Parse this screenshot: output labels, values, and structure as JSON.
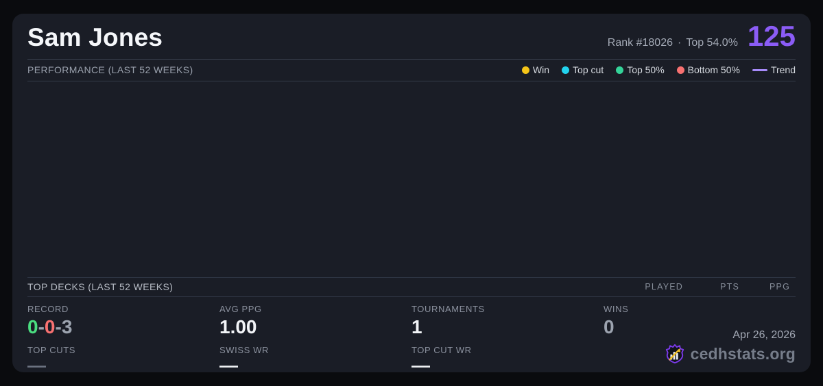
{
  "player": {
    "name": "Sam Jones",
    "rank_label": "Rank #18026",
    "separator": "·",
    "top_percent_label": "Top 54.0%",
    "points": "125"
  },
  "performance": {
    "title": "PERFORMANCE (LAST 52 WEEKS)",
    "legend": {
      "win": {
        "label": "Win",
        "color": "#F5C518"
      },
      "top_cut": {
        "label": "Top cut",
        "color": "#22D3EE"
      },
      "top50": {
        "label": "Top 50%",
        "color": "#34D399"
      },
      "bottom50": {
        "label": "Bottom 50%",
        "color": "#F87171"
      },
      "trend": {
        "label": "Trend",
        "color": "#A78BFA"
      }
    }
  },
  "chart_data": {
    "type": "scatter",
    "title": "PERFORMANCE (LAST 52 WEEKS)",
    "x": [],
    "series": [],
    "legend_position": "top-right",
    "grid": false
  },
  "top_decks": {
    "title": "TOP DECKS (LAST 52 WEEKS)",
    "columns": [
      "PLAYED",
      "PTS",
      "PPG"
    ],
    "rows": []
  },
  "stats": {
    "record": {
      "label": "RECORD",
      "wins": "0",
      "losses": "0",
      "draws": "3",
      "sep": "-"
    },
    "avg_ppg": {
      "label": "AVG PPG",
      "value": "1.00"
    },
    "tournaments": {
      "label": "TOURNAMENTS",
      "value": "1"
    },
    "wins": {
      "label": "WINS",
      "value": "0"
    },
    "top_cuts": {
      "label": "TOP CUTS",
      "value": "—"
    },
    "swiss_wr": {
      "label": "SWISS WR",
      "value": "—"
    },
    "top_cut_wr": {
      "label": "TOP CUT WR",
      "value": "—"
    }
  },
  "footer": {
    "date": "Apr 26, 2026",
    "brand": "cedhstats.org"
  },
  "colors": {
    "page_background": "#0A0B0E",
    "card_background": "#1A1D26",
    "accent_purple": "#8B5CF6",
    "record_win_green": "#4ADE80",
    "record_loss_red": "#F87171",
    "record_draw_gray": "#9CA3AF",
    "logo_outline_purple": "#7C3AED",
    "logo_arrow_gold": "#F2C027"
  }
}
